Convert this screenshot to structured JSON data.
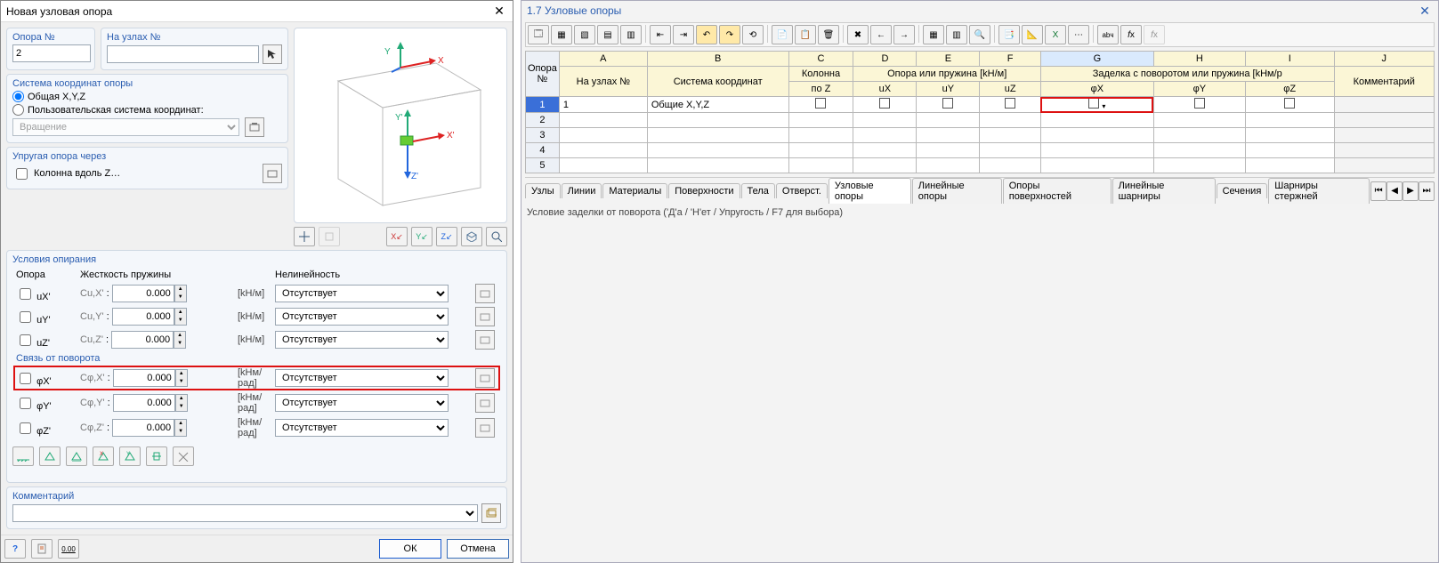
{
  "dialog": {
    "title": "Новая узловая опора",
    "support_no": {
      "label": "Опора №",
      "value": "2"
    },
    "on_nodes": {
      "label": "На узлах №",
      "value": ""
    },
    "csys": {
      "group_title": "Система координат опоры",
      "global_label": "Общая X,Y,Z",
      "user_label": "Пользовательская система координат:",
      "user_value": "Вращение"
    },
    "elastic": {
      "group_title": "Упругая опора через",
      "col_z_label": "Колонна вдоль Z…"
    },
    "conditions": {
      "group_title": "Условия опирания",
      "col_support": "Опора",
      "col_stiffness": "Жесткость пружины",
      "col_nl": "Нелинейность",
      "rows_trans": [
        {
          "name": "uX'",
          "c": "Cu,X'",
          "cs": ":",
          "val": "0.000",
          "unit": "[kН/м]",
          "nl": "Отсутствует"
        },
        {
          "name": "uY'",
          "c": "Cu,Y'",
          "cs": ":",
          "val": "0.000",
          "unit": "[kН/м]",
          "nl": "Отсутствует"
        },
        {
          "name": "uZ'",
          "c": "Cu,Z'",
          "cs": ":",
          "val": "0.000",
          "unit": "[kН/м]",
          "nl": "Отсутствует"
        }
      ],
      "rot_header": "Связь от поворота",
      "rows_rot": [
        {
          "name": "φX'",
          "c": "Cφ,X'",
          "cs": ":",
          "val": "0.000",
          "unit": "[kНм/рад]",
          "nl": "Отсутствует",
          "hl": true
        },
        {
          "name": "φY'",
          "c": "Cφ,Y'",
          "cs": ":",
          "val": "0.000",
          "unit": "[kНм/рад]",
          "nl": "Отсутствует"
        },
        {
          "name": "φZ'",
          "c": "Cφ,Z'",
          "cs": ":",
          "val": "0.000",
          "unit": "[kНм/рад]",
          "nl": "Отсутствует"
        }
      ]
    },
    "comment": {
      "group_title": "Комментарий",
      "value": ""
    },
    "footer": {
      "ok": "ОК",
      "cancel": "Отмена"
    }
  },
  "table": {
    "title": "1.7 Узловые опоры",
    "colhdr_letters": [
      "A",
      "B",
      "C",
      "D",
      "E",
      "F",
      "G",
      "H",
      "I",
      "J"
    ],
    "corner": "Опора\n№",
    "group_kolonna": "Колонна",
    "group_spring_t": "Опора или пружина [kН/м]",
    "group_spring_r": "Заделка с поворотом или пружина [kНм/р",
    "col_onnodes": "На узлах №",
    "col_csys": "Система координат",
    "col_z": "по Z",
    "col_ux": "uX",
    "col_uy": "uY",
    "col_uz": "uZ",
    "col_phx": "φX",
    "col_phy": "φY",
    "col_phz": "φZ",
    "col_comment": "Комментарий",
    "rows": [
      {
        "no": "1",
        "nodes": "1",
        "csys": "Общие X,Y,Z"
      }
    ],
    "empty_rows": [
      "2",
      "3",
      "4",
      "5"
    ],
    "tabs": [
      "Узлы",
      "Линии",
      "Материалы",
      "Поверхности",
      "Тела",
      "Отверст.",
      "Узловые опоры",
      "Линейные опоры",
      "Опоры поверхностей",
      "Линейные шарниры",
      "Сечения",
      "Шарниры стержней"
    ],
    "active_tab": "Узловые опоры",
    "status": "Условие заделки от поворота ('Д'а / 'Н'ет / Упругость / F7 для выбора)"
  }
}
